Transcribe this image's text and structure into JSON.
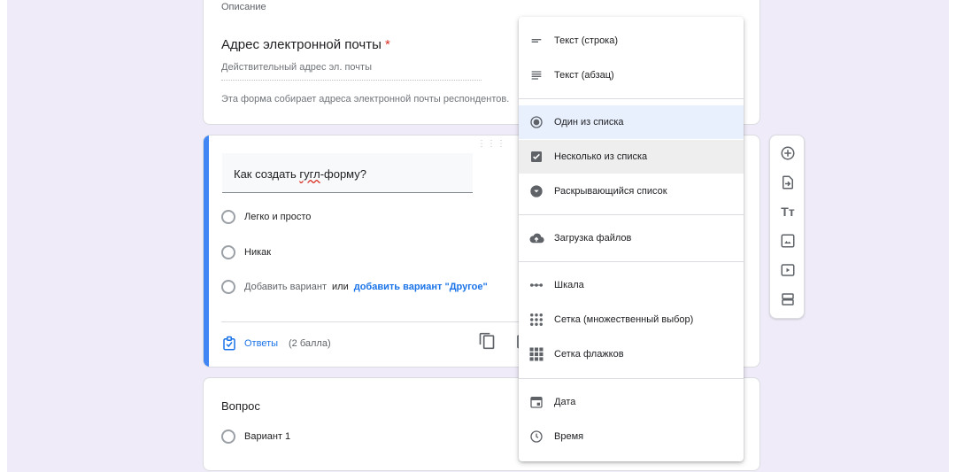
{
  "email_card": {
    "cut_text": "Описание",
    "title": "Адрес электронной почты",
    "required_mark": "*",
    "placeholder": "Действительный адрес эл. почты",
    "note": "Эта форма собирает адреса электронной почты респондентов."
  },
  "active_question": {
    "drag_handle": "⋮⋮⋮",
    "title_before": "Как создать ",
    "title_misspelled": "гугл",
    "title_after": "-форму?",
    "options": [
      "Легко и просто",
      "Никак"
    ],
    "add_option": "Добавить вариант",
    "or": "или",
    "add_other": "добавить вариант \"Другое\"",
    "answers_label": "Ответы",
    "points": "(2 балла)"
  },
  "next_question": {
    "title": "Вопрос",
    "option": "Вариант 1"
  },
  "menu": {
    "items": [
      {
        "label": "Текст (строка)",
        "icon": "short-text-icon"
      },
      {
        "label": "Текст (абзац)",
        "icon": "paragraph-icon"
      },
      {
        "label": "Один из списка",
        "icon": "radio-icon",
        "state": "selected"
      },
      {
        "label": "Несколько из списка",
        "icon": "checkbox-icon",
        "state": "hover"
      },
      {
        "label": "Раскрывающийся список",
        "icon": "dropdown-icon"
      },
      {
        "label": "Загрузка файлов",
        "icon": "cloud-upload-icon"
      },
      {
        "label": "Шкала",
        "icon": "linear-scale-icon"
      },
      {
        "label": "Сетка (множественный выбор)",
        "icon": "radio-grid-icon"
      },
      {
        "label": "Сетка флажков",
        "icon": "checkbox-grid-icon"
      },
      {
        "label": "Дата",
        "icon": "calendar-icon"
      },
      {
        "label": "Время",
        "icon": "clock-icon"
      }
    ]
  },
  "toolbar": {
    "tools": [
      "add-question-icon",
      "import-questions-icon",
      "add-title-icon",
      "add-image-icon",
      "add-video-icon",
      "add-section-icon"
    ],
    "title_tool_glyph": "Tт"
  },
  "colors": {
    "accent": "#1a73e8",
    "active_bar": "#4285f4",
    "background": "#f0ebf8",
    "required": "#d93025",
    "selected_item": "#e8f0fe"
  }
}
